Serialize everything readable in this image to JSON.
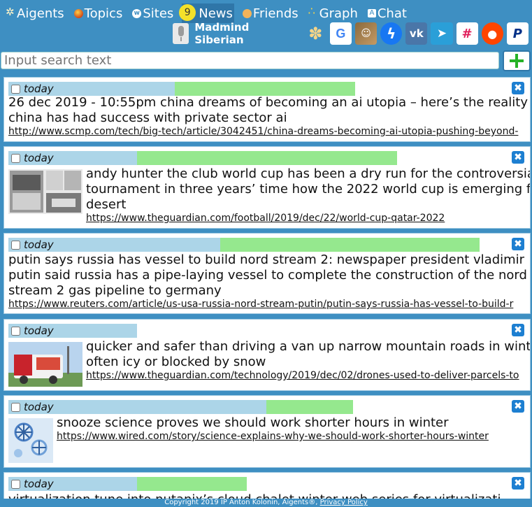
{
  "nav": {
    "agents": "Aigents",
    "topics": "Topics",
    "sites": "Sites",
    "news": "News",
    "news_badge": "9",
    "friends": "Friends",
    "graph": "Graph",
    "chat": "Chat"
  },
  "user": {
    "name": "Madmind Siberian"
  },
  "social_icons": [
    "aigents-icon",
    "google-icon",
    "profile-photo",
    "messenger-icon",
    "vk-icon",
    "telegram-icon",
    "slack-icon",
    "reddit-icon",
    "paypal-icon"
  ],
  "search": {
    "placeholder": "Input search text"
  },
  "items": [
    {
      "date": "today",
      "blue": 0.32,
      "green_end": 0.68,
      "title_lines": [
        "26 dec 2019 - 10:55pm china dreams of becoming an ai utopia – here’s the reality",
        "china has had success with private sector ai"
      ],
      "url": "http://www.scmp.com/tech/big-tech/article/3042451/china-dreams-becoming-ai-utopia-pushing-beyond-"
    },
    {
      "date": "today",
      "blue": 0.25,
      "green_end": 0.76,
      "title_lines": [
        "andy hunter the club world cup has been a dry run for the controversial",
        "tournament in three years’ time how the 2022 world cup is emerging fro",
        "desert"
      ],
      "url": "https://www.theguardian.com/football/2019/dec/22/world-cup-qatar-2022"
    },
    {
      "date": "today",
      "blue": 0.41,
      "green_end": 0.91,
      "title_lines": [
        "putin says russia has vessel to build nord stream 2: newspaper president vladimir",
        "putin said russia has a pipe-laying vessel to complete the construction of the nord",
        "stream 2 gas pipeline to germany"
      ],
      "url": "https://www.reuters.com/article/us-usa-russia-nord-stream-putin/putin-says-russia-has-vessel-to-build-r"
    },
    {
      "date": "today",
      "blue": 0.25,
      "green_end": 0.25,
      "title_lines": [
        "quicker and safer than driving a van up narrow mountain roads in winte",
        "often icy or blocked by snow"
      ],
      "url": "https://www.theguardian.com/technology/2019/dec/02/drones-used-to-deliver-parcels-to"
    },
    {
      "date": "today",
      "blue": 0.5,
      "green_end": 0.66,
      "title_lines": [
        "snooze science proves we should work shorter hours in winter"
      ],
      "url": "https://www.wired.com/story/science-explains-why-we-should-work-shorter-hours-winter"
    },
    {
      "date": "today",
      "blue": 0.25,
      "green_end": 0.46,
      "title_lines": [
        "virtualization tune into nutanix’s cloud chalet winter web series for virtualizati"
      ],
      "url": ""
    }
  ],
  "footer": {
    "copyright": "Copyright 2019 IP Anton Kolonin, Aigents®,",
    "privacy": "Privacy Policy"
  }
}
